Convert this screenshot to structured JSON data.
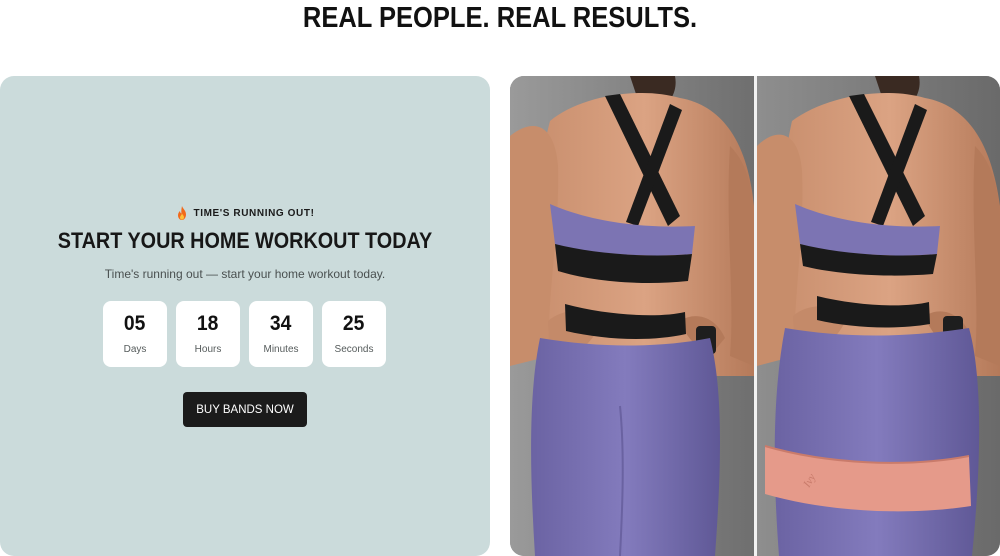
{
  "headline": "REAL PEOPLE. REAL RESULTS.",
  "promo": {
    "kicker": "TIME'S RUNNING OUT!",
    "title": "START YOUR HOME WORKOUT TODAY",
    "subtitle": "Time's running out — start your home workout today.",
    "countdown": [
      {
        "value": "05",
        "label": "Days"
      },
      {
        "value": "18",
        "label": "Hours"
      },
      {
        "value": "34",
        "label": "Minutes"
      },
      {
        "value": "25",
        "label": "Seconds"
      }
    ],
    "cta_label": "BUY BANDS NOW",
    "kicker_icon": "fire-icon"
  },
  "photos": {
    "before_alt": "before-photo",
    "after_alt": "after-photo",
    "band_text": "Ivy"
  },
  "colors": {
    "card_bg": "#cbdbdb",
    "button_bg": "#1b1b1b",
    "leggings": "#7b73b4",
    "band": "#e59a8a"
  }
}
